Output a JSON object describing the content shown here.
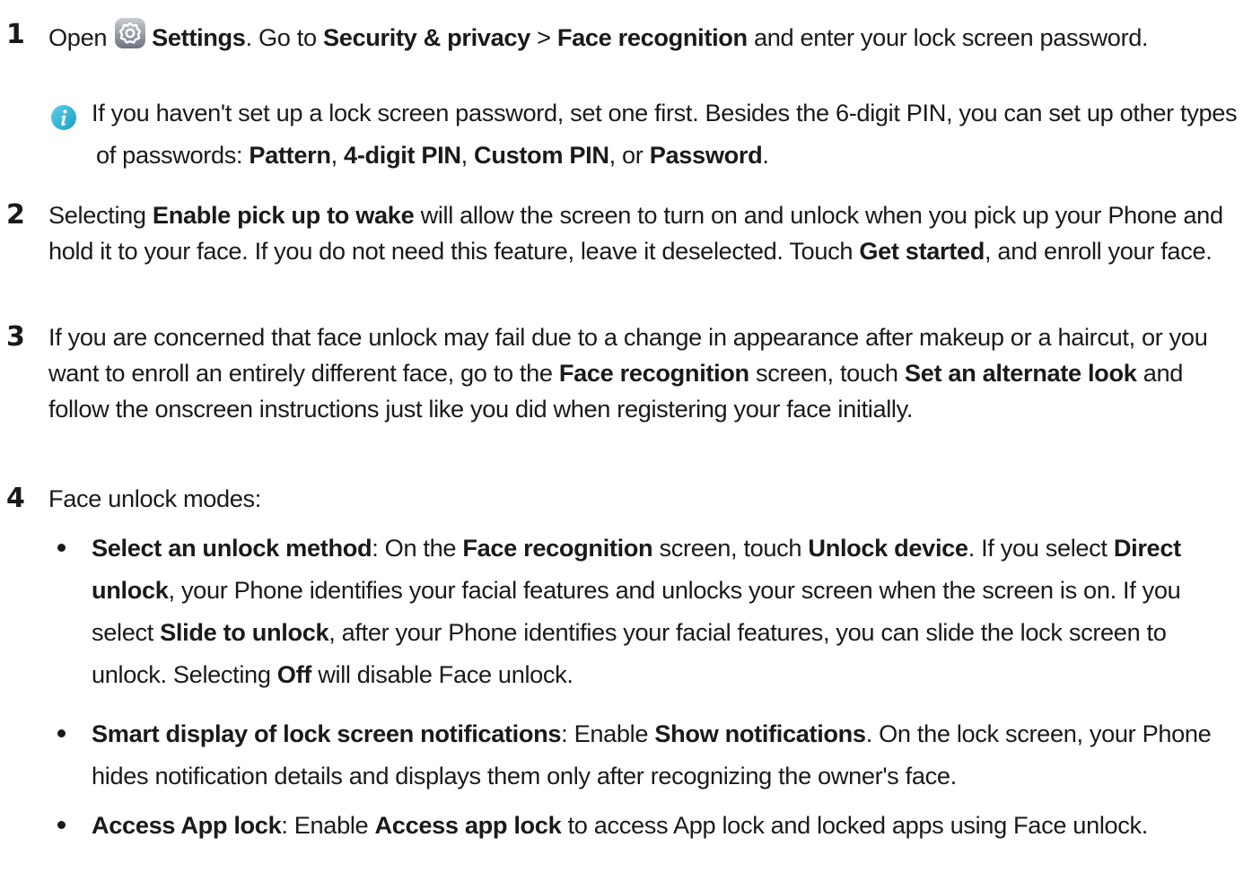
{
  "steps": [
    {
      "number": "1",
      "s1_a": "Open",
      "s1_b": "Settings",
      "s1_c": ". Go to",
      "s1_d": "Security & privacy",
      "s1_e": " > ",
      "s1_f": "Face recognition",
      "s1_g": " and enter your lock screen password.",
      "icon": "settings-gear-icon",
      "note": {
        "icon": "info-icon",
        "n_a": "If you haven't set up a lock screen password, set one first. Besides the 6-digit PIN, you can set up other types of passwords: ",
        "n_b": "Pattern",
        "n_c": ", ",
        "n_d": "4-digit PIN",
        "n_e": ", ",
        "n_f": "Custom PIN",
        "n_g": ", or ",
        "n_h": "Password",
        "n_i": "."
      }
    },
    {
      "number": "2",
      "a": "Selecting ",
      "b": "Enable pick up to wake",
      "c": " will allow the screen to turn on and unlock when you pick up your Phone and hold it to your face. If you do not need this feature, leave it deselected. Touch ",
      "d": "Get started",
      "e": ", and enroll your face."
    },
    {
      "number": "3",
      "a": "If you are concerned that face unlock may fail due to a change in appearance after makeup or a haircut, or you want to enroll an entirely different face, go to the ",
      "b": "Face recognition",
      "c": " screen, touch ",
      "d": "Set an alternate look",
      "e": " and follow the onscreen instructions just like you did when registering your face initially."
    },
    {
      "number": "4",
      "a": "Face unlock modes:",
      "bullets": [
        {
          "a": "Select an unlock method",
          "b": ": On the ",
          "c": "Face recognition",
          "d": " screen, touch ",
          "e": "Unlock device",
          "f": ". If you select ",
          "g": "Direct unlock",
          "h": ", your Phone identifies your facial features and unlocks your screen when the screen is on. If you select ",
          "i": "Slide to unlock",
          "j": ", after your Phone identifies your facial features, you can slide the lock screen to unlock. Selecting ",
          "k": "Off",
          "l": " will disable Face unlock."
        },
        {
          "a": "Smart display of lock screen notifications",
          "b": ": Enable ",
          "c": "Show notifications",
          "d": ". On the lock screen, your Phone hides notification details and displays them only after recognizing the owner's face."
        },
        {
          "a": "Access App lock",
          "b": ": Enable ",
          "c": "Access app lock",
          "d": " to access App lock and locked apps using Face unlock."
        }
      ]
    }
  ]
}
